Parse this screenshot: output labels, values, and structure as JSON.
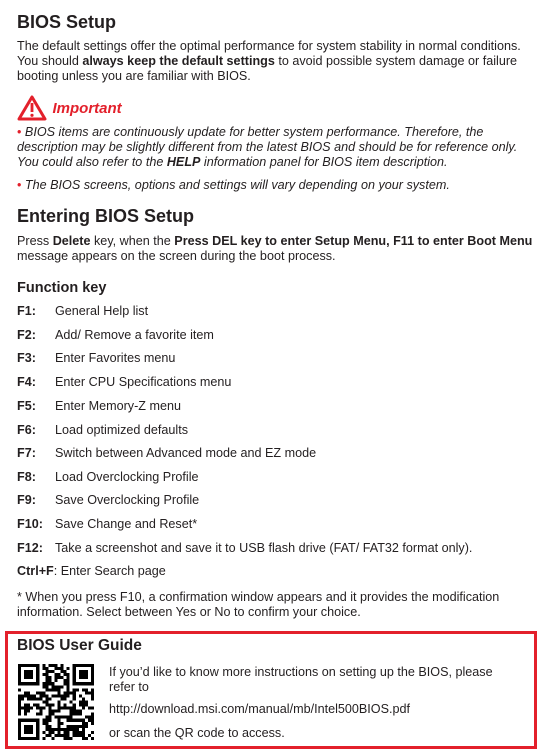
{
  "title": "BIOS Setup",
  "intro": {
    "before": "The default settings offer the optimal performance for system stability in normal conditions. You should ",
    "bold": "always keep the default settings",
    "after": " to avoid possible system damage or failure booting unless you are familiar with BIOS."
  },
  "important": {
    "label": "Important",
    "icon": "warning-triangle-icon",
    "bullets": [
      {
        "before": "BIOS items are continuously update for better system performance. Therefore, the description may be slightly different from the latest BIOS and should be for reference only. You could also refer to the ",
        "bold": "HELP",
        "after": " information panel for BIOS item description."
      },
      {
        "before": "The BIOS screens, options and settings will vary depending on your system.",
        "bold": "",
        "after": ""
      }
    ]
  },
  "entering": {
    "heading": "Entering BIOS Setup",
    "p1": "Press ",
    "b1": "Delete",
    "p2": " key, when the ",
    "b2": "Press DEL key to enter Setup Menu, F11 to enter Boot Menu",
    "p3": " message appears on the screen during the boot process."
  },
  "function_keys": {
    "heading": "Function key",
    "items": [
      {
        "key": "F1:",
        "desc": "General Help list"
      },
      {
        "key": "F2:",
        "desc": "Add/ Remove a favorite item"
      },
      {
        "key": "F3:",
        "desc": "Enter Favorites menu"
      },
      {
        "key": "F4:",
        "desc": "Enter CPU Specifications menu"
      },
      {
        "key": "F5:",
        "desc": "Enter Memory-Z menu"
      },
      {
        "key": "F6:",
        "desc": "Load optimized defaults"
      },
      {
        "key": "F7:",
        "desc": "Switch between Advanced mode and EZ mode"
      },
      {
        "key": "F8:",
        "desc": "Load Overclocking Profile"
      },
      {
        "key": "F9:",
        "desc": "Save Overclocking Profile"
      },
      {
        "key": "F10:",
        "desc": "Save Change and Reset*"
      },
      {
        "key": "F12:",
        "desc": "Take a screenshot and save it to USB flash drive (FAT/ FAT32 format only)."
      }
    ],
    "ctrlf_key": "Ctrl+F",
    "ctrlf_desc": ": Enter Search page",
    "footnote": "* When you press F10, a confirmation window appears and it provides the modification information. Select between Yes or No to confirm your choice."
  },
  "user_guide": {
    "heading": "BIOS User Guide",
    "text1": "If you’d like to know more instructions on setting up the BIOS, please refer to",
    "url": "http://download.msi.com/manual/mb/Intel500BIOS.pdf",
    "text2": "or scan the QR code to access.",
    "border_color": "#e3202b"
  },
  "colors": {
    "accent": "#e3202b",
    "text": "#231f20"
  }
}
